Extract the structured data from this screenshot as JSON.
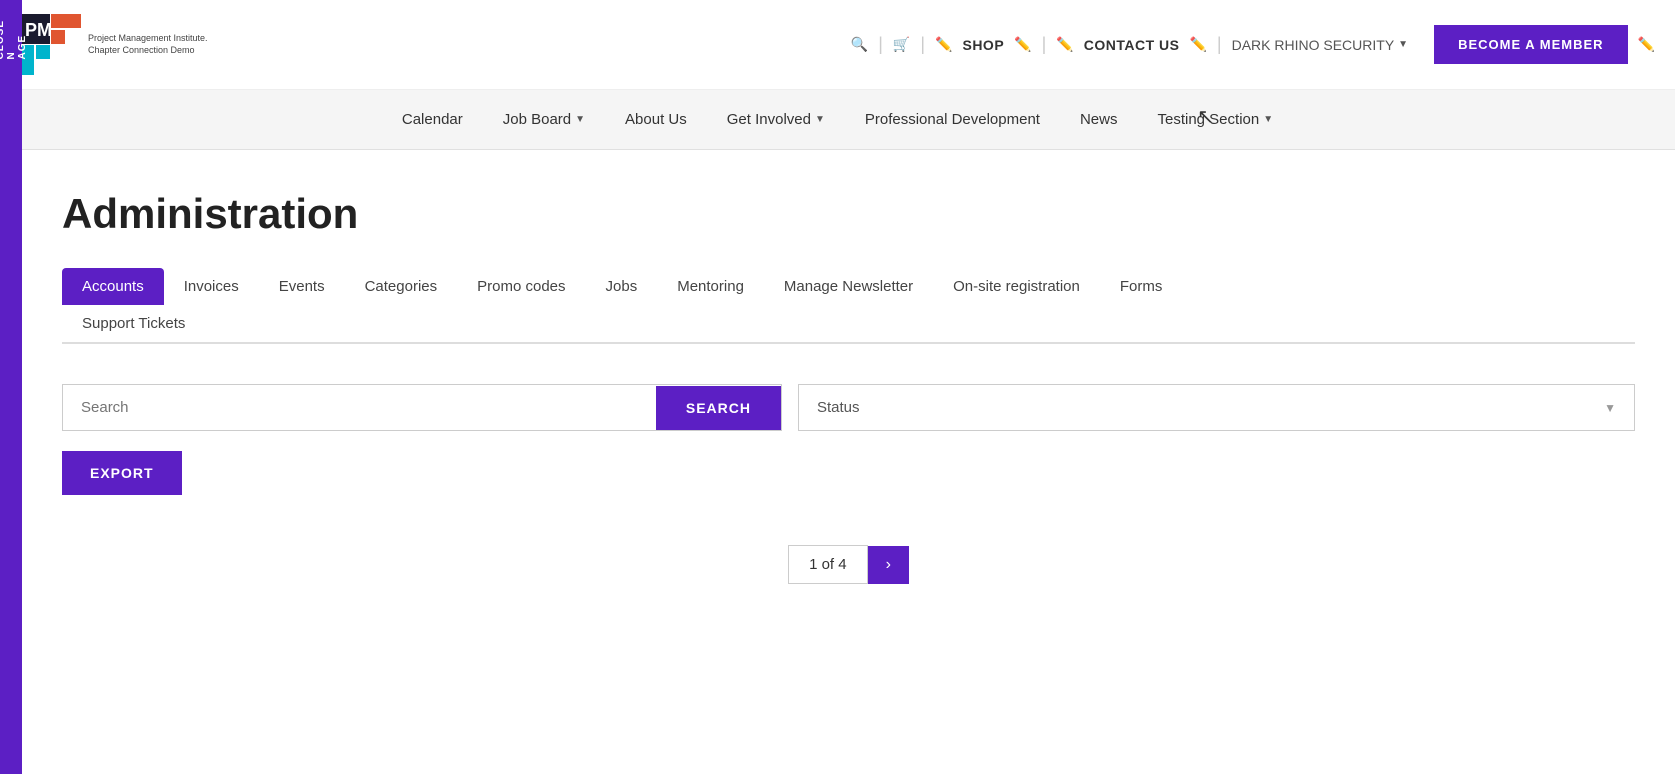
{
  "leftBar": {
    "items": [
      "CLOSE",
      "N",
      "AGE"
    ]
  },
  "header": {
    "logo": {
      "org": "Project Management Institute.",
      "sub": "Chapter Connection Demo"
    },
    "icons": {
      "search": "🔍",
      "cart": "🛒",
      "pencil": "✏️"
    },
    "shop_label": "SHOP",
    "contact_label": "CONTACT US",
    "darkrhino_label": "DARK RHINO SECURITY",
    "become_member_label": "BECOME A MEMBER"
  },
  "nav": {
    "items": [
      {
        "label": "Calendar",
        "has_dropdown": false
      },
      {
        "label": "Job Board",
        "has_dropdown": true
      },
      {
        "label": "About Us",
        "has_dropdown": false
      },
      {
        "label": "Get Involved",
        "has_dropdown": true
      },
      {
        "label": "Professional Development",
        "has_dropdown": false
      },
      {
        "label": "News",
        "has_dropdown": false
      },
      {
        "label": "Testing Section",
        "has_dropdown": true
      }
    ]
  },
  "page": {
    "title": "Administration"
  },
  "admin_tabs": {
    "row1": [
      {
        "label": "Accounts",
        "active": true
      },
      {
        "label": "Invoices",
        "active": false
      },
      {
        "label": "Events",
        "active": false
      },
      {
        "label": "Categories",
        "active": false
      },
      {
        "label": "Promo codes",
        "active": false
      },
      {
        "label": "Jobs",
        "active": false
      },
      {
        "label": "Mentoring",
        "active": false
      },
      {
        "label": "Manage Newsletter",
        "active": false
      },
      {
        "label": "On-site registration",
        "active": false
      },
      {
        "label": "Forms",
        "active": false
      }
    ],
    "row2": [
      {
        "label": "Support Tickets",
        "active": false
      }
    ]
  },
  "search": {
    "placeholder": "Search",
    "button_label": "SEARCH",
    "status_placeholder": "Status"
  },
  "export": {
    "button_label": "EXPORT"
  },
  "pagination": {
    "current": "1",
    "of_label": "of",
    "total": "4",
    "next_arrow": "›"
  }
}
